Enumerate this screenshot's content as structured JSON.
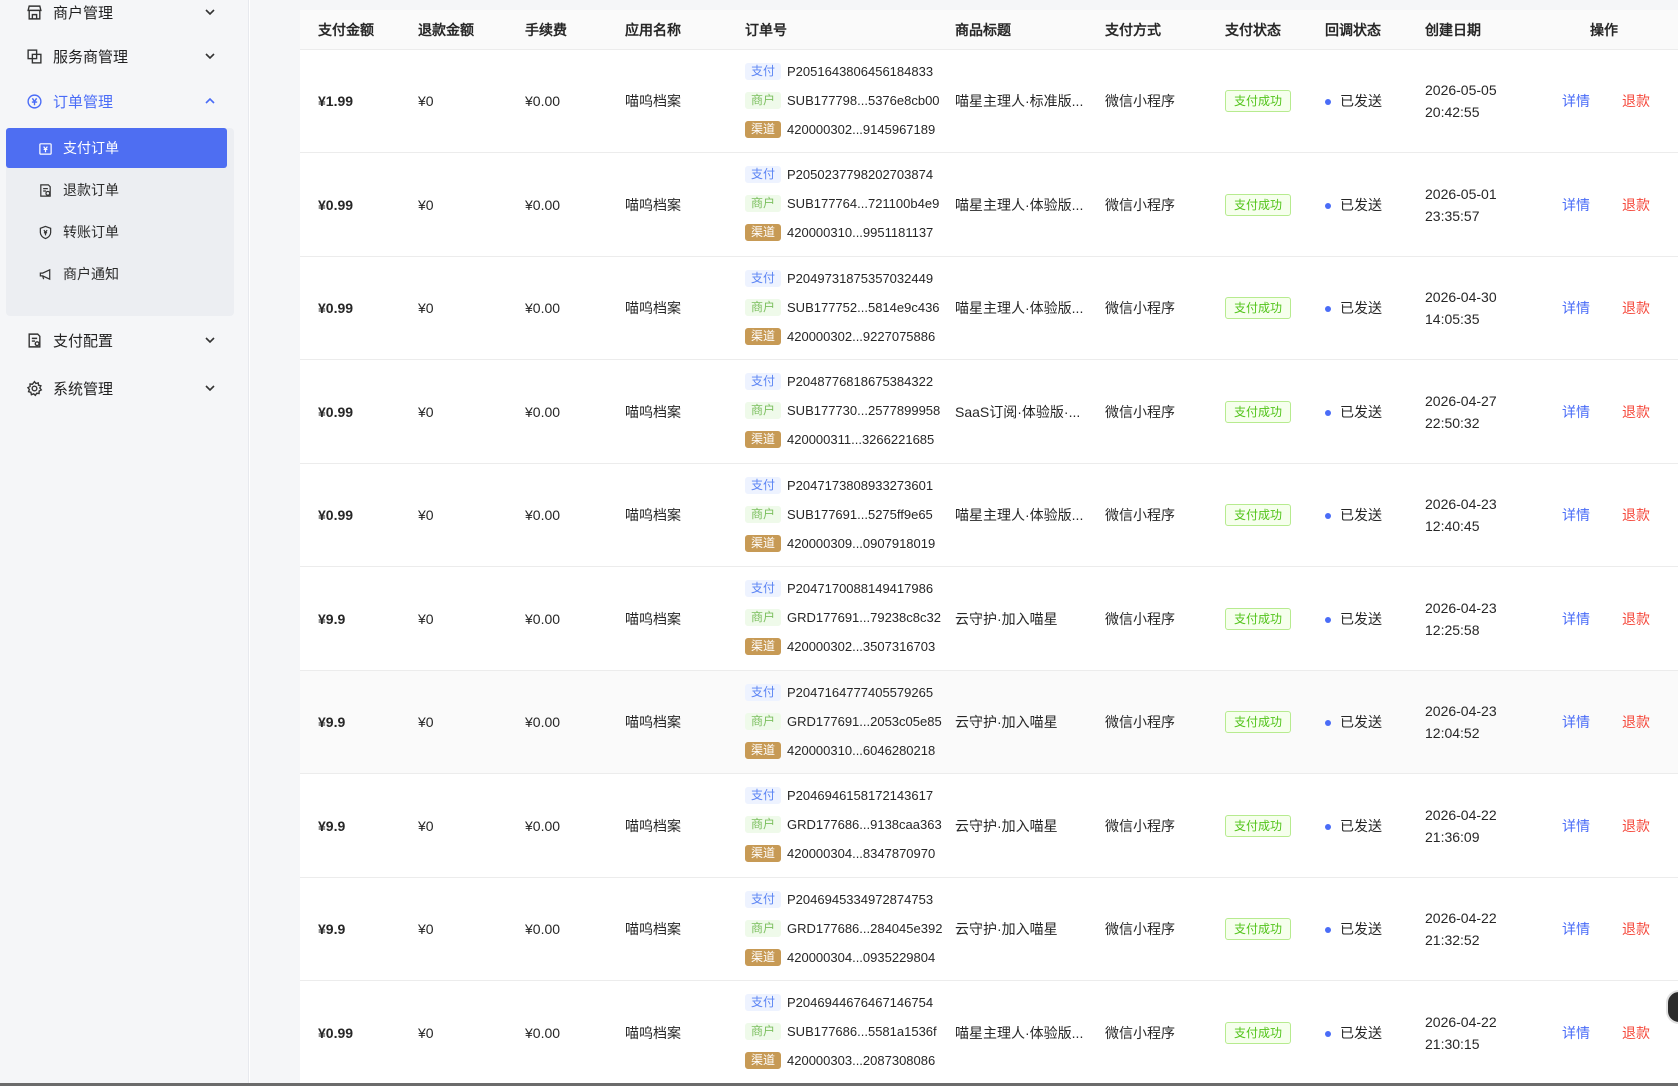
{
  "sidebar": {
    "menu": [
      {
        "label": "商户管理",
        "icon": "store-icon"
      },
      {
        "label": "服务商管理",
        "icon": "layers-icon"
      },
      {
        "label": "订单管理",
        "icon": "order-icon"
      },
      {
        "label": "支付配置",
        "icon": "config-doc-icon"
      },
      {
        "label": "系统管理",
        "icon": "gear-icon"
      }
    ],
    "submenu": [
      {
        "label": "支付订单",
        "icon": "yen-card-icon"
      },
      {
        "label": "退款订单",
        "icon": "refund-doc-icon"
      },
      {
        "label": "转账订单",
        "icon": "shield-yen-icon"
      },
      {
        "label": "商户通知",
        "icon": "megaphone-icon"
      }
    ],
    "accent_color": "#4e6ef2"
  },
  "table": {
    "headers": [
      "支付金额",
      "退款金额",
      "手续费",
      "应用名称",
      "订单号",
      "商品标题",
      "支付方式",
      "支付状态",
      "回调状态",
      "创建日期",
      "操作"
    ],
    "tag_labels": {
      "pay": "支付",
      "mch": "商户",
      "chn": "渠道"
    },
    "action_labels": {
      "detail": "详情",
      "refund": "退款"
    },
    "rows": [
      {
        "amount": "¥1.99",
        "refund": "¥0",
        "fee": "¥0.00",
        "app": "喵呜档案",
        "pay_no": "P2051643806456184833",
        "mch_no": "SUB177798...5376e8cb00",
        "chn_no": "420000302...9145967189",
        "title": "喵星主理人·标准版...",
        "method": "微信小程序",
        "status": "支付成功",
        "callback": "已发送",
        "date": "2026-05-05",
        "time": "20:42:55"
      },
      {
        "amount": "¥0.99",
        "refund": "¥0",
        "fee": "¥0.00",
        "app": "喵呜档案",
        "pay_no": "P2050237798202703874",
        "mch_no": "SUB177764...721100b4e9",
        "chn_no": "420000310...9951181137",
        "title": "喵星主理人·体验版...",
        "method": "微信小程序",
        "status": "支付成功",
        "callback": "已发送",
        "date": "2026-05-01",
        "time": "23:35:57"
      },
      {
        "amount": "¥0.99",
        "refund": "¥0",
        "fee": "¥0.00",
        "app": "喵呜档案",
        "pay_no": "P2049731875357032449",
        "mch_no": "SUB177752...5814e9c436",
        "chn_no": "420000302...9227075886",
        "title": "喵星主理人·体验版...",
        "method": "微信小程序",
        "status": "支付成功",
        "callback": "已发送",
        "date": "2026-04-30",
        "time": "14:05:35"
      },
      {
        "amount": "¥0.99",
        "refund": "¥0",
        "fee": "¥0.00",
        "app": "喵呜档案",
        "pay_no": "P2048776818675384322",
        "mch_no": "SUB177730...2577899958",
        "chn_no": "420000311...3266221685",
        "title": "SaaS订阅·体验版·...",
        "method": "微信小程序",
        "status": "支付成功",
        "callback": "已发送",
        "date": "2026-04-27",
        "time": "22:50:32"
      },
      {
        "amount": "¥0.99",
        "refund": "¥0",
        "fee": "¥0.00",
        "app": "喵呜档案",
        "pay_no": "P2047173808933273601",
        "mch_no": "SUB177691...5275ff9e65",
        "chn_no": "420000309...0907918019",
        "title": "喵星主理人·体验版...",
        "method": "微信小程序",
        "status": "支付成功",
        "callback": "已发送",
        "date": "2026-04-23",
        "time": "12:40:45"
      },
      {
        "amount": "¥9.9",
        "refund": "¥0",
        "fee": "¥0.00",
        "app": "喵呜档案",
        "pay_no": "P2047170088149417986",
        "mch_no": "GRD177691...79238c8c32",
        "chn_no": "420000302...3507316703",
        "title": "云守护·加入喵星",
        "method": "微信小程序",
        "status": "支付成功",
        "callback": "已发送",
        "date": "2026-04-23",
        "time": "12:25:58"
      },
      {
        "amount": "¥9.9",
        "refund": "¥0",
        "fee": "¥0.00",
        "app": "喵呜档案",
        "pay_no": "P2047164777405579265",
        "mch_no": "GRD177691...2053c05e85",
        "chn_no": "420000310...6046280218",
        "title": "云守护·加入喵星",
        "method": "微信小程序",
        "status": "支付成功",
        "callback": "已发送",
        "date": "2026-04-23",
        "time": "12:04:52"
      },
      {
        "amount": "¥9.9",
        "refund": "¥0",
        "fee": "¥0.00",
        "app": "喵呜档案",
        "pay_no": "P2046946158172143617",
        "mch_no": "GRD177686...9138caa363",
        "chn_no": "420000304...8347870970",
        "title": "云守护·加入喵星",
        "method": "微信小程序",
        "status": "支付成功",
        "callback": "已发送",
        "date": "2026-04-22",
        "time": "21:36:09"
      },
      {
        "amount": "¥9.9",
        "refund": "¥0",
        "fee": "¥0.00",
        "app": "喵呜档案",
        "pay_no": "P2046945334972874753",
        "mch_no": "GRD177686...284045e392",
        "chn_no": "420000304...0935229804",
        "title": "云守护·加入喵星",
        "method": "微信小程序",
        "status": "支付成功",
        "callback": "已发送",
        "date": "2026-04-22",
        "time": "21:32:52"
      },
      {
        "amount": "¥0.99",
        "refund": "¥0",
        "fee": "¥0.00",
        "app": "喵呜档案",
        "pay_no": "P2046944676467146754",
        "mch_no": "SUB177686...5581a1536f",
        "chn_no": "420000303...2087308086",
        "title": "喵星主理人·体验版...",
        "method": "微信小程序",
        "status": "支付成功",
        "callback": "已发送",
        "date": "2026-04-22",
        "time": "21:30:15"
      }
    ]
  }
}
